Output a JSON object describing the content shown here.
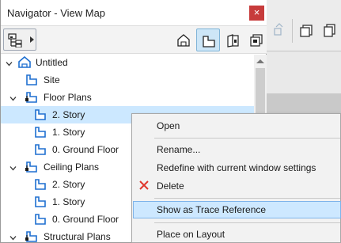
{
  "navigator": {
    "title": "Navigator - View Map",
    "close_glyph": "×",
    "toolbar": {
      "tree_button_icon": "tree-structure-icon",
      "map_buttons": [
        {
          "icon": "project-map-icon",
          "selected": false
        },
        {
          "icon": "view-map-icon",
          "selected": true
        },
        {
          "icon": "layout-book-icon",
          "selected": false
        },
        {
          "icon": "publisher-sets-icon",
          "selected": false
        }
      ]
    },
    "tree": [
      {
        "label": "Untitled",
        "level": 0,
        "expanded": true,
        "icon": "project-icon"
      },
      {
        "label": "Site",
        "level": 1,
        "icon": "view-icon"
      },
      {
        "label": "Floor Plans",
        "level": 1,
        "expanded": true,
        "icon": "folder-view-icon"
      },
      {
        "label": "2. Story",
        "level": 2,
        "icon": "view-icon",
        "selected": true
      },
      {
        "label": "1. Story",
        "level": 2,
        "icon": "view-icon"
      },
      {
        "label": "0. Ground Floor",
        "level": 2,
        "icon": "view-icon"
      },
      {
        "label": "Ceiling Plans",
        "level": 1,
        "expanded": true,
        "icon": "folder-view-icon"
      },
      {
        "label": "2. Story",
        "level": 2,
        "icon": "view-icon"
      },
      {
        "label": "1. Story",
        "level": 2,
        "icon": "view-icon"
      },
      {
        "label": "0. Ground Floor",
        "level": 2,
        "icon": "view-icon"
      },
      {
        "label": "Structural Plans",
        "level": 1,
        "expanded": true,
        "icon": "folder-view-icon"
      }
    ]
  },
  "context_menu": {
    "items": [
      {
        "label": "Open"
      },
      {
        "separator": true
      },
      {
        "label": "Rename..."
      },
      {
        "label": "Redefine with current window settings"
      },
      {
        "label": "Delete",
        "icon": "delete-x-icon"
      },
      {
        "separator": true
      },
      {
        "label": "Show as Trace Reference",
        "highlighted": true
      },
      {
        "separator": true
      },
      {
        "label": "Place on Layout"
      }
    ]
  },
  "colors": {
    "selection": "#cce8ff",
    "close_button": "#c73b3b",
    "icon_blue": "#1e6fd0",
    "delete_red": "#e0362c"
  }
}
